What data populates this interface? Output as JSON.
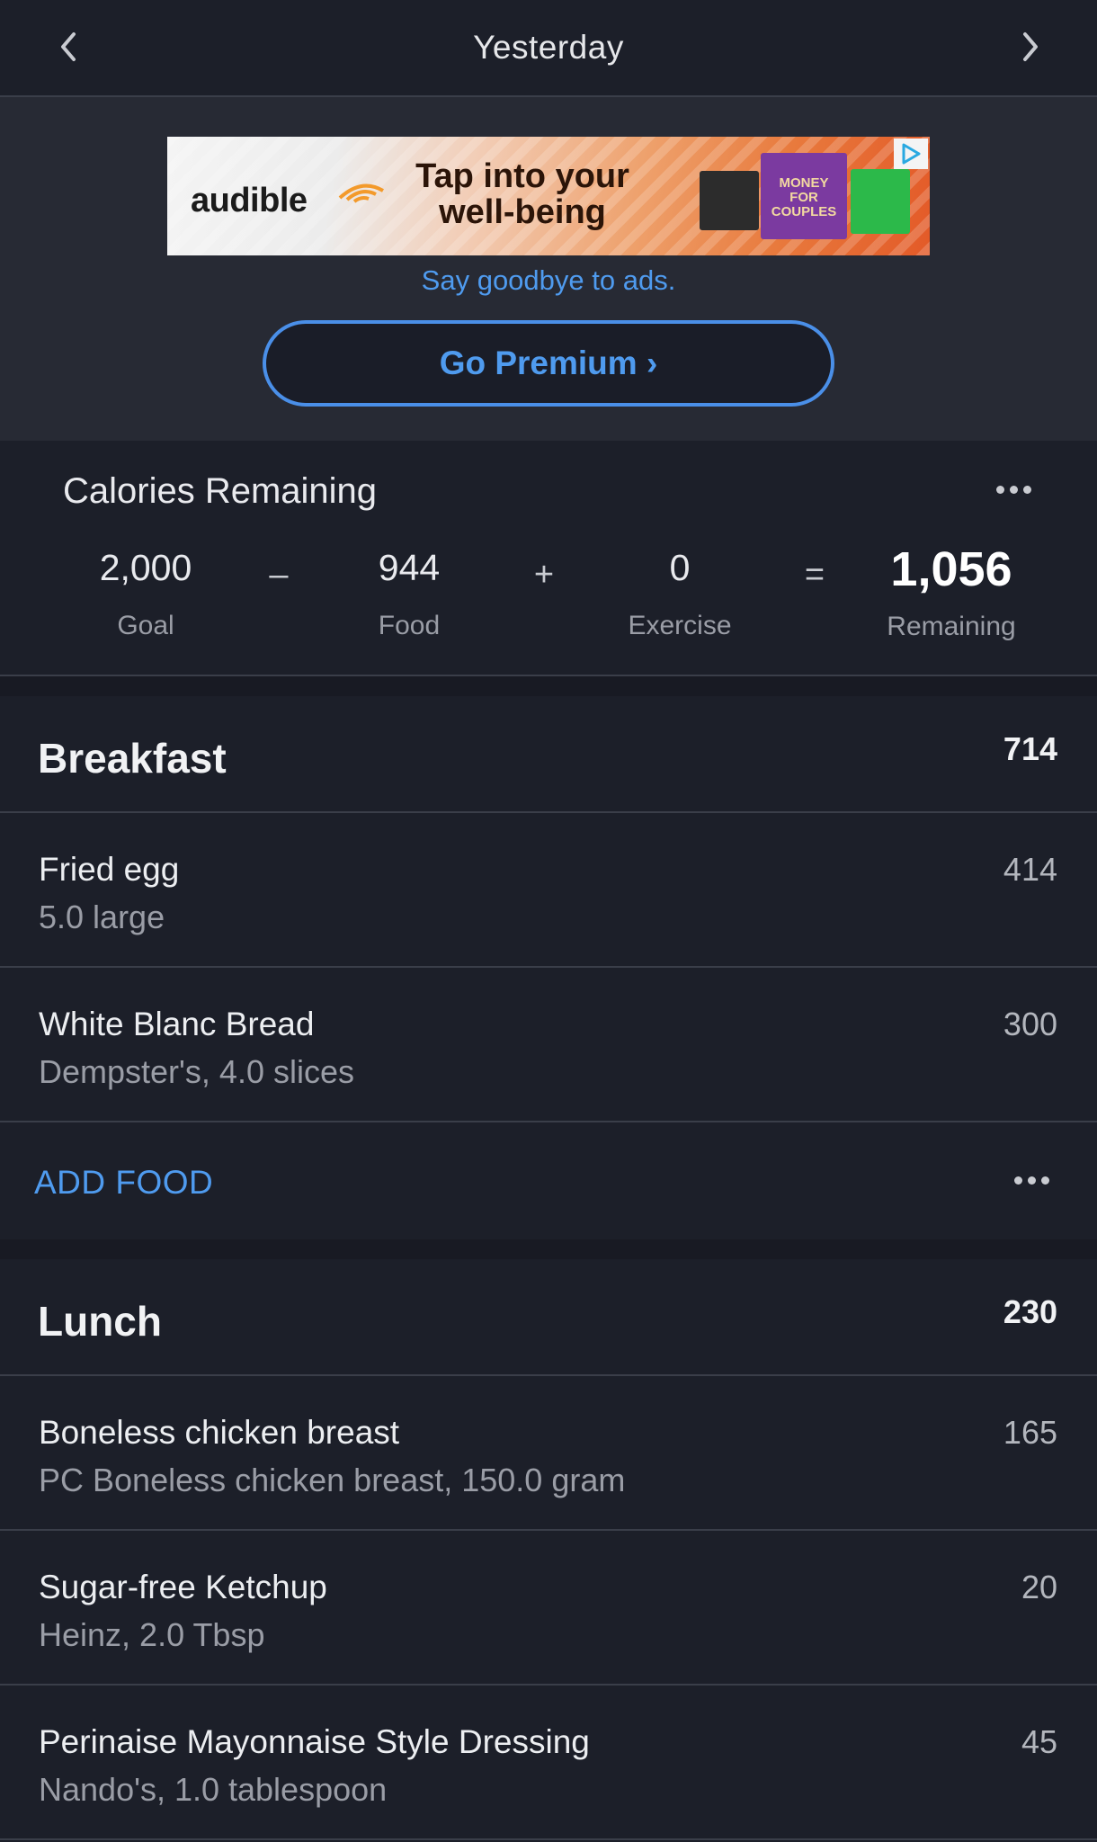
{
  "header": {
    "title": "Yesterday"
  },
  "ad": {
    "brand": "audible",
    "tagline": "Tap into your well-being",
    "book_title": "MONEY FOR COUPLES",
    "note": "Say goodbye to ads.",
    "premium_label": "Go Premium ›"
  },
  "calories": {
    "title": "Calories Remaining",
    "goal": {
      "value": "2,000",
      "label": "Goal"
    },
    "op_minus": "–",
    "food": {
      "value": "944",
      "label": "Food"
    },
    "op_plus": "+",
    "exercise": {
      "value": "0",
      "label": "Exercise"
    },
    "op_equals": "=",
    "remaining": {
      "value": "1,056",
      "label": "Remaining"
    }
  },
  "meals": {
    "breakfast": {
      "name": "Breakfast",
      "total": "714",
      "items": [
        {
          "name": "Fried egg",
          "desc": "5.0 large",
          "cal": "414"
        },
        {
          "name": "White Blanc Bread",
          "desc": "Dempster's, 4.0 slices",
          "cal": "300"
        }
      ],
      "add_label": "ADD FOOD"
    },
    "lunch": {
      "name": "Lunch",
      "total": "230",
      "items": [
        {
          "name": "Boneless chicken breast",
          "desc": "PC Boneless chicken breast, 150.0 gram",
          "cal": "165"
        },
        {
          "name": "Sugar-free Ketchup",
          "desc": "Heinz, 2.0 Tbsp",
          "cal": "20"
        },
        {
          "name": "Perinaise Mayonnaise Style Dressing",
          "desc": "Nando's, 1.0 tablespoon",
          "cal": "45"
        }
      ]
    }
  },
  "colors": {
    "background": "#1c1f29",
    "accent": "#4f9bef",
    "divider": "#3a3e49",
    "muted_text": "#9a9da6"
  }
}
